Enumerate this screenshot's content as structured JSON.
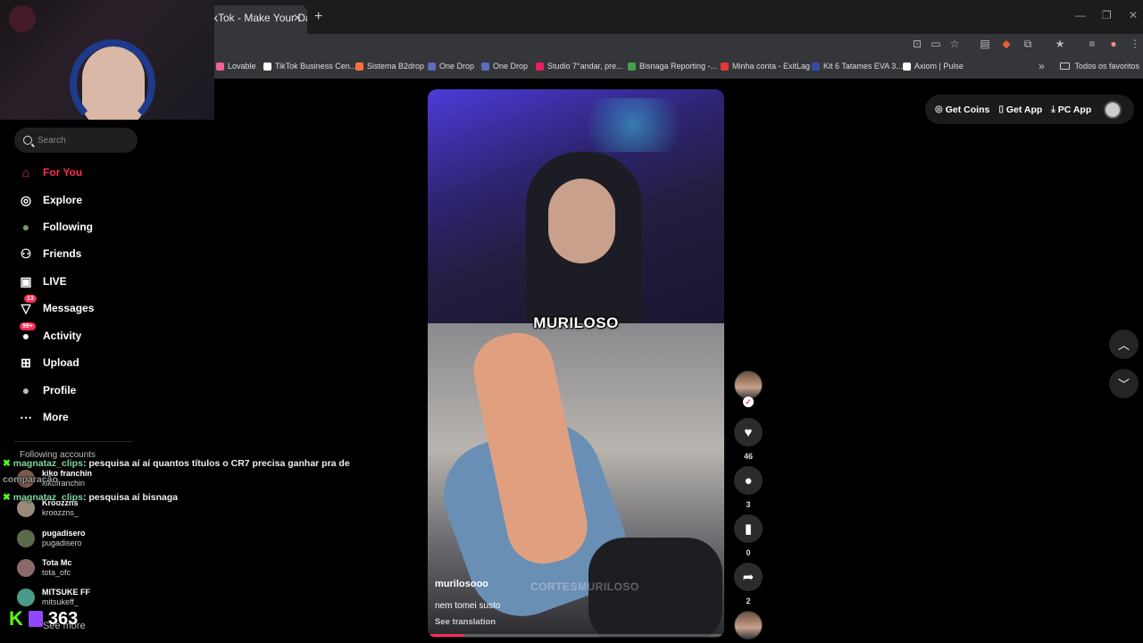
{
  "browser": {
    "tab_title": "kTok - Make Your Day",
    "bookmarks": [
      {
        "label": "Lovable",
        "color": "#f06292"
      },
      {
        "label": "TikTok Business Cen...",
        "color": "#ffffff"
      },
      {
        "label": "Sistema B2drop",
        "color": "#ff7043"
      },
      {
        "label": "One Drop",
        "color": "#5c6bc0"
      },
      {
        "label": "One Drop",
        "color": "#5c6bc0"
      },
      {
        "label": "Studio 7°andar, pre...",
        "color": "#e91e63"
      },
      {
        "label": "Bisnaga Reporting -...",
        "color": "#43a047"
      },
      {
        "label": "Minha conta - ExitLag",
        "color": "#e53935"
      },
      {
        "label": "Kit 6 Tatames EVA 3...",
        "color": "#3949ab"
      },
      {
        "label": "Axiom | Pulse",
        "color": "#ffffff"
      }
    ],
    "bookmarks_folder": "Todos os favoritos"
  },
  "sidebar": {
    "search_placeholder": "Search",
    "nav": [
      {
        "label": "For You",
        "icon": "home-icon",
        "glyph": "⌂"
      },
      {
        "label": "Explore",
        "icon": "compass-icon",
        "glyph": "◎"
      },
      {
        "label": "Following",
        "icon": "following-avatar-icon",
        "glyph": "●"
      },
      {
        "label": "Friends",
        "icon": "friends-icon",
        "glyph": "⚇"
      },
      {
        "label": "LIVE",
        "icon": "live-tv-icon",
        "glyph": "▣"
      },
      {
        "label": "Messages",
        "icon": "messages-icon",
        "glyph": "▽",
        "badge": "13"
      },
      {
        "label": "Activity",
        "icon": "activity-icon",
        "glyph": "●",
        "badge": "99+"
      },
      {
        "label": "Upload",
        "icon": "upload-icon",
        "glyph": "⊞"
      },
      {
        "label": "Profile",
        "icon": "profile-icon",
        "glyph": "●"
      },
      {
        "label": "More",
        "icon": "more-icon",
        "glyph": "⋯"
      }
    ],
    "following_header": "Following accounts",
    "accounts": [
      {
        "name": "kiko franchin",
        "handle": "kikofranchin"
      },
      {
        "name": "Kroozzns",
        "handle": "kroozzns_"
      },
      {
        "name": "pugadisero",
        "handle": "pugadisero"
      },
      {
        "name": "Tota Mc",
        "handle": "tota_ofc"
      },
      {
        "name": "MITSUKE FF",
        "handle": "mitsukeff_"
      }
    ],
    "see_more": "See more"
  },
  "chat": [
    {
      "user": "magnataz_clips",
      "msg": ": pesquisa aí aí quantos títulos o CR7 precisa ganhar pra de"
    },
    {
      "user": "",
      "msg": "comparação"
    },
    {
      "user": "magnataz_clips",
      "msg": ": pesquisa aí bisnaga"
    }
  ],
  "stream": {
    "viewer_count": "363"
  },
  "video": {
    "caption_overlay": "MURILOSO",
    "watermark": "CORTESMURILOSO",
    "author": "murilosooo",
    "description": "nem tomei susto",
    "see_translation": "See translation",
    "progress": 0.12
  },
  "actions": {
    "likes": "46",
    "comments": "3",
    "saves": "0",
    "shares": "2"
  },
  "top_bar": {
    "get_coins": "Get Coins",
    "get_app": "Get App",
    "pc_app": "PC App"
  }
}
